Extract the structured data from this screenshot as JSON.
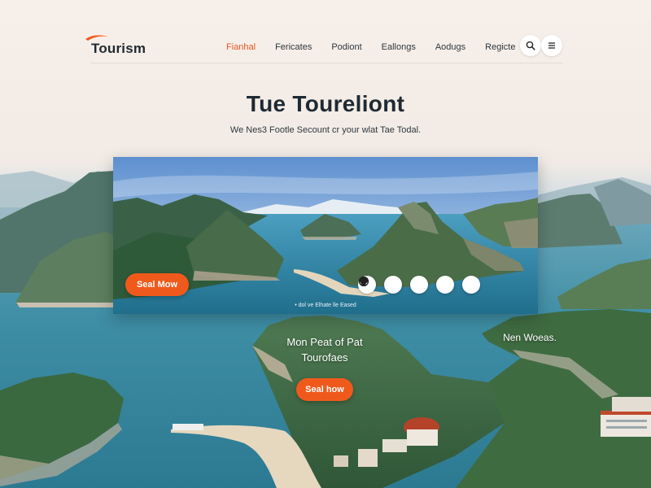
{
  "brand": {
    "name": "Tourism",
    "accent_color": "#ef5a1c"
  },
  "nav": {
    "items": [
      {
        "label": "Fianhal",
        "active": true
      },
      {
        "label": "Fericates",
        "active": false
      },
      {
        "label": "Podiont",
        "active": false
      },
      {
        "label": "Eallongs",
        "active": false
      },
      {
        "label": "Aodugs",
        "active": false
      },
      {
        "label": "Regicte",
        "active": false
      }
    ],
    "icons": [
      "search-icon",
      "menu-icon"
    ]
  },
  "hero": {
    "title": "Tue Toureliont",
    "subtitle": "We Nes3 Footle Secount cr your wlat Tae Todal."
  },
  "banner": {
    "button_label": "Seal Mow",
    "icons": [
      "compass-icon",
      "globe-icon",
      "heart-icon",
      "bottle-icon",
      "flower-icon"
    ],
    "caption": "• dol ve Elhate lle Eased"
  },
  "section": {
    "heading_line1": "Mon Peat of Pat",
    "heading_line2": "Tourofaes",
    "button_label": "Seal how",
    "side_label": "Nen Woeas."
  }
}
